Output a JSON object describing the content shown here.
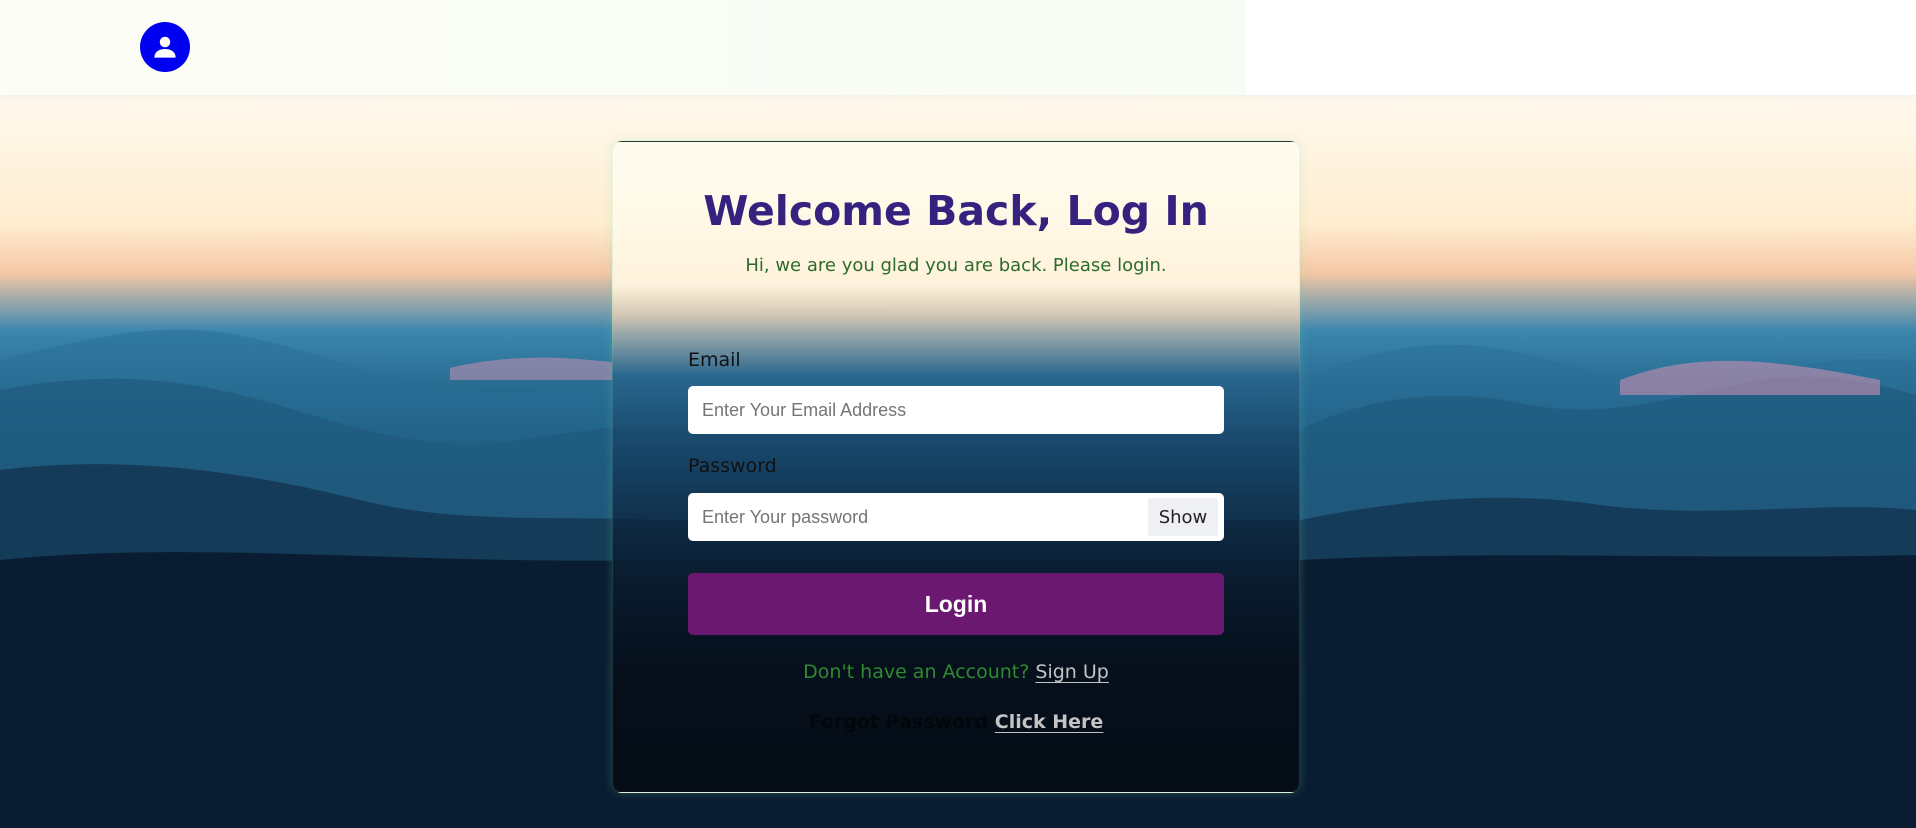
{
  "header": {
    "avatar_icon": "user-icon",
    "avatar_color": "#0000f0"
  },
  "login": {
    "title": "Welcome Back, Log In",
    "subtitle": "Hi, we are you glad you are back. Please login.",
    "email_label": "Email",
    "email_placeholder": "Enter Your Email Address",
    "email_value": "",
    "password_label": "Password",
    "password_placeholder": "Enter Your password",
    "password_value": "",
    "show_label": "Show",
    "login_label": "Login",
    "signup_prompt": "Don't have an Account?",
    "signup_link": "Sign Up",
    "forgot_prompt": "Forgot Password",
    "forgot_link": "Click Here"
  },
  "colors": {
    "title": "#35227f",
    "subtitle": "#2d6b2d",
    "login_button": "#6b1870"
  }
}
